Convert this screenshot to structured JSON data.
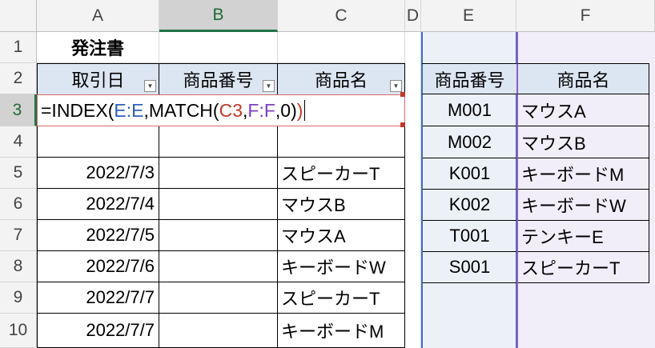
{
  "columns": [
    "A",
    "B",
    "C",
    "D",
    "E",
    "F"
  ],
  "active_column": "B",
  "rows": [
    "1",
    "2",
    "3",
    "4",
    "5",
    "6",
    "7",
    "8",
    "9",
    "10"
  ],
  "active_row": "3",
  "title": "発注書",
  "order_table": {
    "headers": [
      "取引日",
      "商品番号",
      "商品名"
    ],
    "rows": [
      {
        "date": "2022/7/3",
        "code": "",
        "name": "スピーカーT"
      },
      {
        "date": "2022/7/4",
        "code": "",
        "name": "マウスB"
      },
      {
        "date": "2022/7/5",
        "code": "",
        "name": "マウスA"
      },
      {
        "date": "2022/7/6",
        "code": "",
        "name": "キーボードW"
      },
      {
        "date": "2022/7/7",
        "code": "",
        "name": "スピーカーT"
      },
      {
        "date": "2022/7/7",
        "code": "",
        "name": "キーボードM"
      }
    ]
  },
  "formula": {
    "parts": [
      "=INDEX(",
      "E:E",
      ",MATCH(",
      "C3",
      ",",
      "F:F",
      ",0)",
      ")"
    ]
  },
  "lookup_table": {
    "headers": [
      "商品番号",
      "商品名"
    ],
    "rows": [
      {
        "code": "M001",
        "name": "マウスA"
      },
      {
        "code": "M002",
        "name": "マウスB"
      },
      {
        "code": "K001",
        "name": "キーボードM"
      },
      {
        "code": "K002",
        "name": "キーボードW"
      },
      {
        "code": "T001",
        "name": "テンキーE"
      },
      {
        "code": "S001",
        "name": "スピーカーT"
      }
    ]
  },
  "colors": {
    "accent": "#217346",
    "range_e": "#3a6fc4",
    "range_f": "#8a5cc4",
    "formula_ref": "#c0392b"
  }
}
